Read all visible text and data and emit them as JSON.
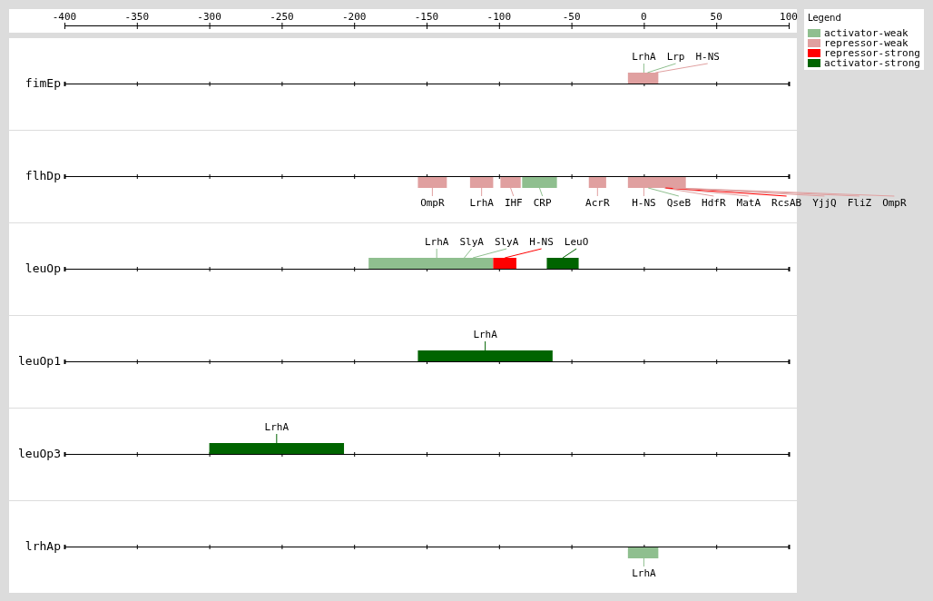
{
  "axis": {
    "ticks": [
      "-400",
      "-350",
      "-300",
      "-250",
      "-200",
      "-150",
      "-100",
      "-50",
      "0",
      "50",
      "100"
    ]
  },
  "legend": {
    "title": "Legend",
    "items": [
      {
        "kind": "activator-weak",
        "label": "activator-weak",
        "color": "#8fbf8f"
      },
      {
        "kind": "repressor-weak",
        "label": "repressor-weak",
        "color": "#e0a0a0"
      },
      {
        "kind": "repressor-strong",
        "label": "repressor-strong",
        "color": "#ff0000"
      },
      {
        "kind": "activator-strong",
        "label": "activator-strong",
        "color": "#006400"
      }
    ]
  },
  "tracks": [
    {
      "name": "fimEp",
      "sites": [
        {
          "tf": "LrhA",
          "kind": "activator-weak"
        },
        {
          "tf": "Lrp",
          "kind": "activator-weak"
        },
        {
          "tf": "H-NS",
          "kind": "repressor-weak"
        }
      ]
    },
    {
      "name": "flhDp",
      "sites": [
        {
          "tf": "OmpR",
          "kind": "repressor-weak"
        },
        {
          "tf": "LrhA",
          "kind": "repressor-weak"
        },
        {
          "tf": "IHF",
          "kind": "repressor-weak"
        },
        {
          "tf": "CRP",
          "kind": "activator-weak"
        },
        {
          "tf": "AcrR",
          "kind": "repressor-weak"
        },
        {
          "tf": "H-NS",
          "kind": "repressor-weak"
        },
        {
          "tf": "QseB",
          "kind": "activator-weak"
        },
        {
          "tf": "HdfR",
          "kind": "repressor-weak"
        },
        {
          "tf": "MatA",
          "kind": "repressor-weak"
        },
        {
          "tf": "RcsAB",
          "kind": "repressor-strong"
        },
        {
          "tf": "YjjQ",
          "kind": "repressor-weak"
        },
        {
          "tf": "FliZ",
          "kind": "repressor-weak"
        },
        {
          "tf": "OmpR",
          "kind": "repressor-weak"
        }
      ]
    },
    {
      "name": "leuOp",
      "sites": [
        {
          "tf": "LrhA",
          "kind": "activator-weak"
        },
        {
          "tf": "SlyA",
          "kind": "activator-weak"
        },
        {
          "tf": "SlyA",
          "kind": "activator-weak"
        },
        {
          "tf": "H-NS",
          "kind": "repressor-strong"
        },
        {
          "tf": "LeuO",
          "kind": "activator-strong"
        }
      ]
    },
    {
      "name": "leuOp1",
      "sites": [
        {
          "tf": "LrhA",
          "kind": "activator-strong"
        }
      ]
    },
    {
      "name": "leuOp3",
      "sites": [
        {
          "tf": "LrhA",
          "kind": "activator-strong"
        }
      ]
    },
    {
      "name": "lrhAp",
      "sites": [
        {
          "tf": "LrhA",
          "kind": "activator-weak"
        }
      ]
    }
  ]
}
